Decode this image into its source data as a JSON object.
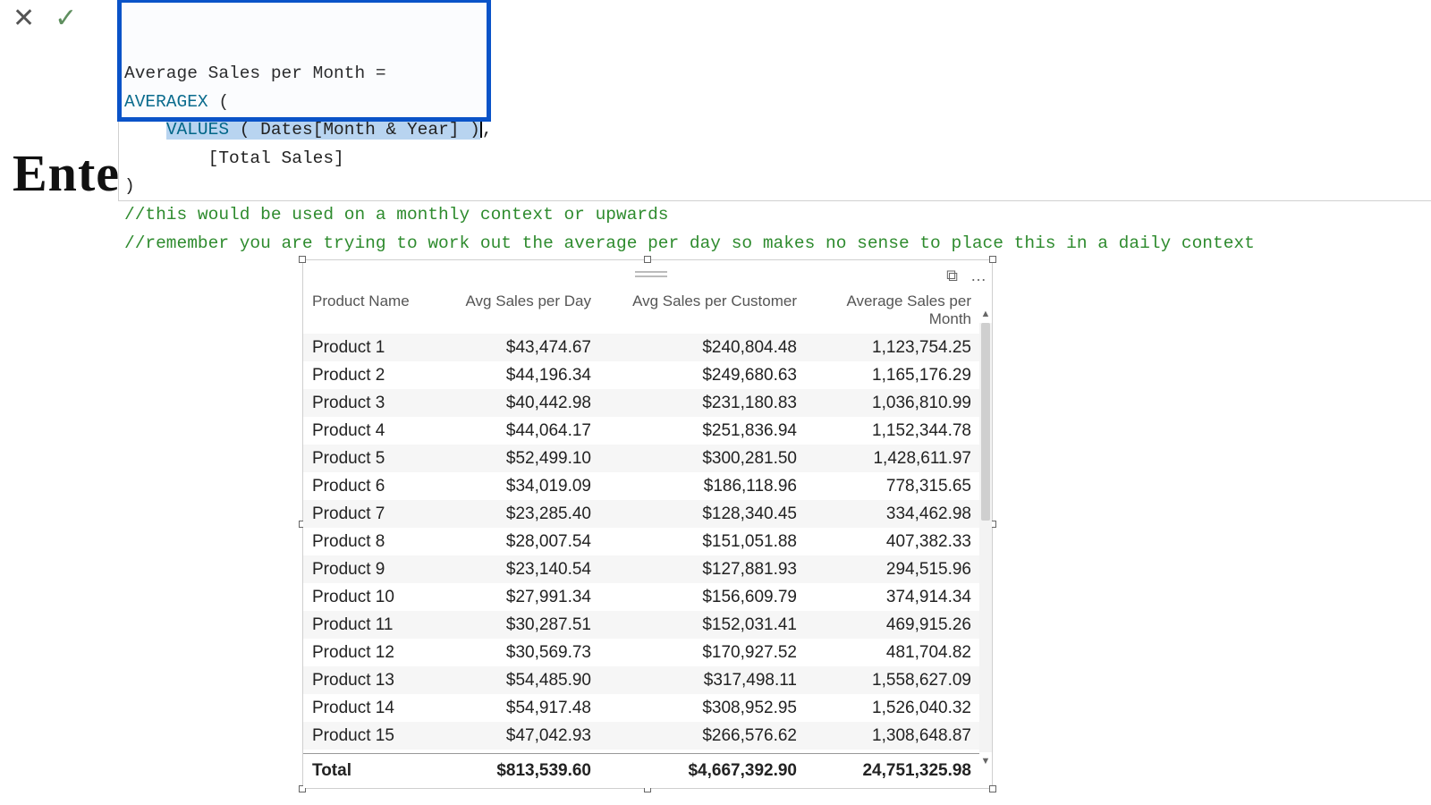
{
  "formula": {
    "line1_label": "Average Sales per Month = ",
    "line2_fn": "AVERAGEX",
    "line2_rest": " (",
    "line3_indent": "    ",
    "line3_sel_fn": "VALUES",
    "line3_sel_rest": " ( Dates[Month & Year] )",
    "line3_close": ",",
    "line4": "        [Total Sales]",
    "line5": ")",
    "comment1": "//this would be used on a monthly context or upwards",
    "comment2": "//remember you are trying to work out the average per day so makes no sense to place this in a daily context"
  },
  "watermark": "Ente",
  "table": {
    "headers": [
      "Product Name",
      "Avg Sales per Day",
      "Avg Sales per Customer",
      "Average Sales per Month"
    ],
    "rows": [
      [
        "Product 1",
        "$43,474.67",
        "$240,804.48",
        "1,123,754.25"
      ],
      [
        "Product 2",
        "$44,196.34",
        "$249,680.63",
        "1,165,176.29"
      ],
      [
        "Product 3",
        "$40,442.98",
        "$231,180.83",
        "1,036,810.99"
      ],
      [
        "Product 4",
        "$44,064.17",
        "$251,836.94",
        "1,152,344.78"
      ],
      [
        "Product 5",
        "$52,499.10",
        "$300,281.50",
        "1,428,611.97"
      ],
      [
        "Product 6",
        "$34,019.09",
        "$186,118.96",
        "778,315.65"
      ],
      [
        "Product 7",
        "$23,285.40",
        "$128,340.45",
        "334,462.98"
      ],
      [
        "Product 8",
        "$28,007.54",
        "$151,051.88",
        "407,382.33"
      ],
      [
        "Product 9",
        "$23,140.54",
        "$127,881.93",
        "294,515.96"
      ],
      [
        "Product 10",
        "$27,991.34",
        "$156,609.79",
        "374,914.34"
      ],
      [
        "Product 11",
        "$30,287.51",
        "$152,031.41",
        "469,915.26"
      ],
      [
        "Product 12",
        "$30,569.73",
        "$170,927.52",
        "481,704.82"
      ],
      [
        "Product 13",
        "$54,485.90",
        "$317,498.11",
        "1,558,627.09"
      ],
      [
        "Product 14",
        "$54,917.48",
        "$308,952.95",
        "1,526,040.32"
      ],
      [
        "Product 15",
        "$47,042.93",
        "$266,576.62",
        "1,308,648.87"
      ]
    ],
    "total": [
      "Total",
      "$813,539.60",
      "$4,667,392.90",
      "24,751,325.98"
    ]
  },
  "icons": {
    "cancel": "✕",
    "commit": "✓",
    "focus": "⧉",
    "more": "…",
    "up": "▲",
    "down": "▼"
  }
}
